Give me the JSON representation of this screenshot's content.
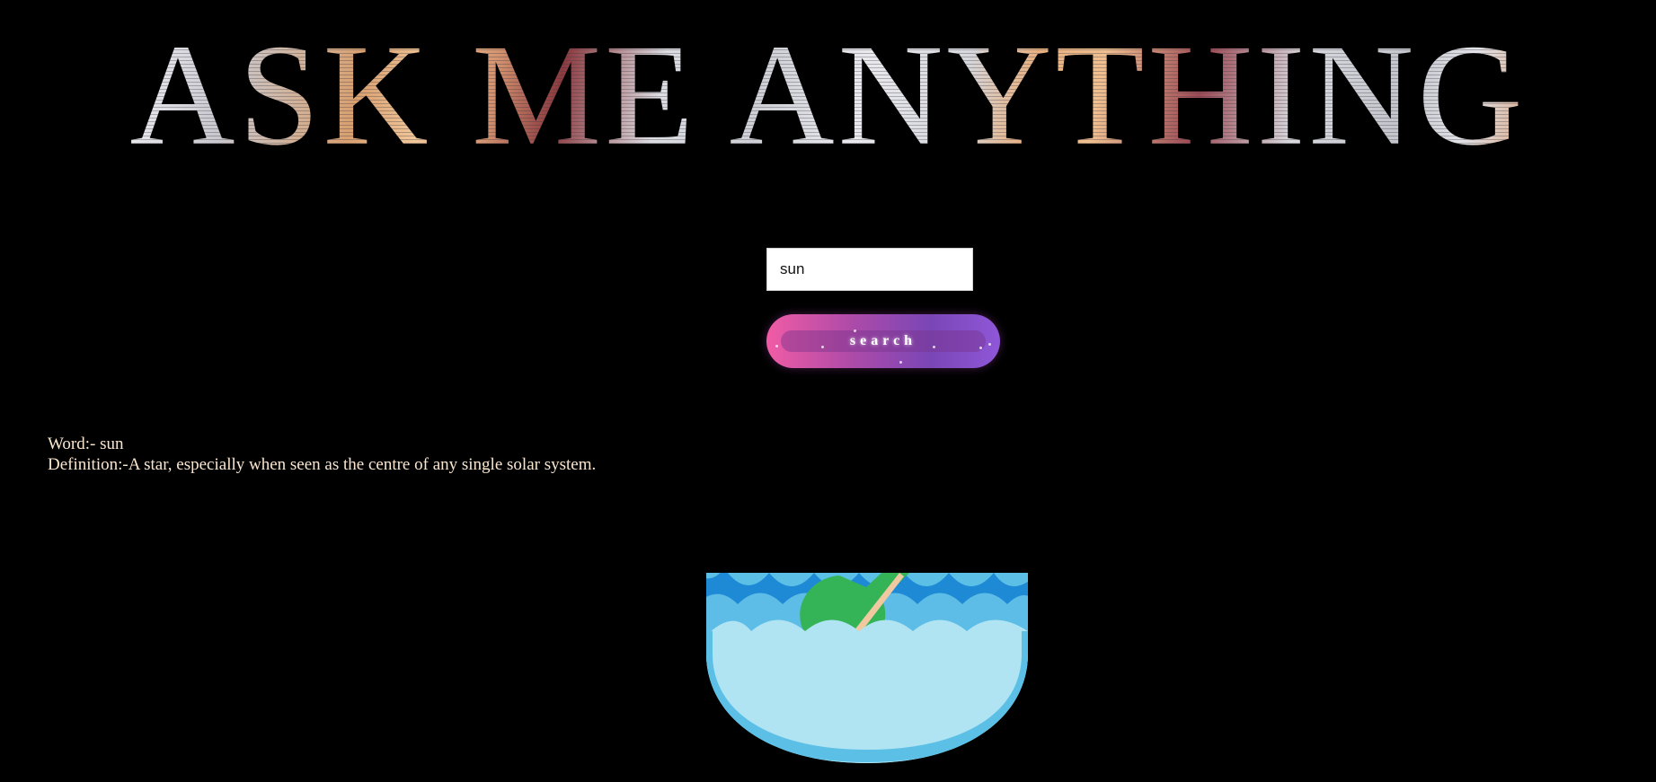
{
  "header": {
    "title": "ASK ME ANYTHING"
  },
  "search": {
    "value": "sun",
    "button_label": "search"
  },
  "result": {
    "word_prefix": "Word:-",
    "word": "sun",
    "definition_prefix": "Definition:-",
    "definition": "A star, especially when seen as the centre of any single solar system."
  },
  "illustration": {
    "name": "message-in-a-bottle",
    "colors": {
      "bowl_outer": "#5cc0e6",
      "bowl_inner": "#b0e4f3",
      "wave_dark": "#1e8ad6",
      "wave_mid": "#5dbde6",
      "bottle": "#34b457",
      "cork": "#a0745a",
      "message": "#f0c9a0"
    }
  },
  "colors": {
    "background": "#000000",
    "result_text": "#fbe7cf",
    "button_gradient_start": "#f15ca5",
    "button_gradient_end": "#8f57d8"
  }
}
